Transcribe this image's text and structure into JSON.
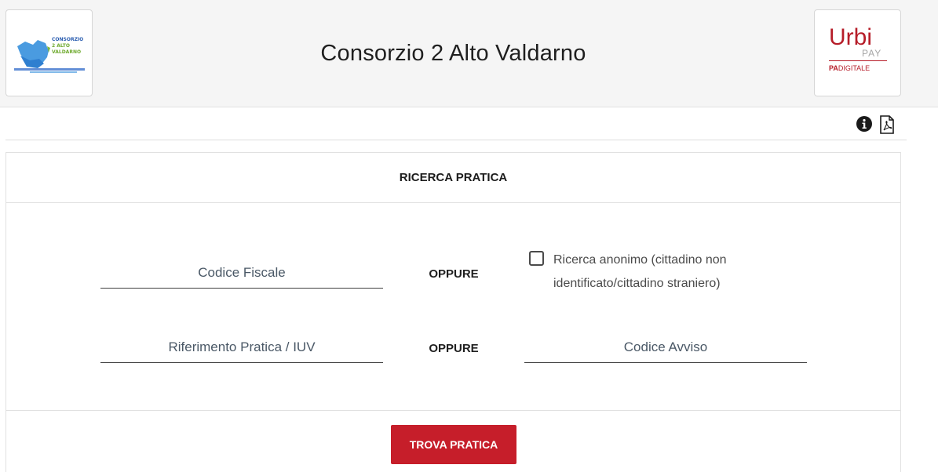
{
  "header": {
    "title": "Consorzio 2 Alto Valdarno",
    "left_logo": {
      "icon": "consorzio-logo-icon",
      "line1": "CONSORZIO",
      "line2": "2 ALTO",
      "line3": "VALDARNO"
    },
    "right_logo": {
      "icon": "urbipay-logo-icon",
      "brand": "Urbi",
      "sub": "PAY",
      "tag_bold": "PA",
      "tag_rest": "DIGITALE"
    }
  },
  "toolbar": {
    "info_icon": "info-icon",
    "pdf_icon": "pdf-icon"
  },
  "search": {
    "title": "RICERCA PRATICA",
    "codice_fiscale_placeholder": "Codice Fiscale",
    "or_label_1": "OPPURE",
    "anon_label": "Ricerca anonimo (cittadino non identificato/cittadino straniero)",
    "anon_checked": false,
    "riferimento_placeholder": "Riferimento Pratica / IUV",
    "or_label_2": "OPPURE",
    "codice_avviso_placeholder": "Codice Avviso",
    "submit_label": "TROVA PRATICA"
  },
  "colors": {
    "accent": "#c61e2a",
    "header_bg": "#f5f5f5"
  }
}
